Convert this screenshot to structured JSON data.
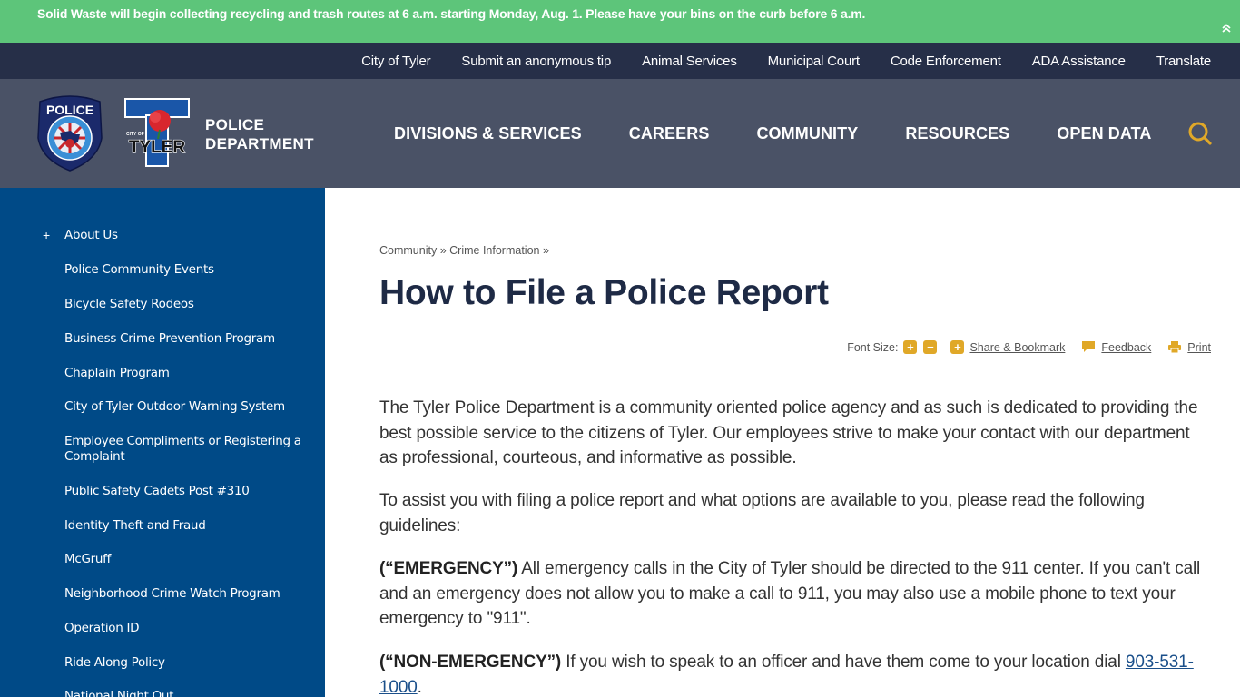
{
  "alert": {
    "message": "Solid Waste will begin collecting recycling and trash routes at 6 a.m. starting Monday, Aug. 1. Please have your bins on the curb before 6 a.m.",
    "collapse_icon": "double-chevron-up-icon"
  },
  "utility_nav": {
    "links": [
      "City of Tyler",
      "Submit an anonymous tip",
      "Animal Services",
      "Municipal Court",
      "Code Enforcement",
      "ADA Assistance",
      "Translate"
    ]
  },
  "header": {
    "police_badge_text": "POLICE",
    "tyler_logo_small": "CITY OF",
    "tyler_logo_text": "TYLER",
    "dept_line1": "POLICE",
    "dept_line2": "DEPARTMENT",
    "nav": [
      "DIVISIONS & SERVICES",
      "CAREERS",
      "COMMUNITY",
      "RESOURCES",
      "OPEN DATA"
    ],
    "search_icon": "search-icon"
  },
  "sidebar": {
    "expand_symbol": "+",
    "items": [
      "About Us",
      "Police Community Events",
      "Bicycle Safety Rodeos",
      "Business Crime Prevention Program",
      "Chaplain Program",
      "City of Tyler Outdoor Warning System",
      "Employee Compliments or Registering a Complaint",
      "Public Safety Cadets Post #310",
      "Identity Theft and Fraud",
      "McGruff",
      "Neighborhood Crime Watch Program",
      "Operation ID",
      "Ride Along Policy",
      "National Night Out"
    ]
  },
  "content": {
    "breadcrumb": [
      "Community",
      "Crime Information"
    ],
    "breadcrumb_sep": "»",
    "title": "How to File a Police Report",
    "tools": {
      "font_size_label": "Font Size:",
      "increase": "+",
      "decrease": "−",
      "share_label": "Share & Bookmark",
      "feedback_label": "Feedback",
      "print_label": "Print"
    },
    "paragraphs": {
      "p1": "The Tyler Police Department is a community oriented police agency and as such is dedicated to providing the best possible service to the citizens of Tyler. Our employees strive to make your contact with our department as professional, courteous, and informative as possible.",
      "p2": "To assist you with filing a police report and what options are available to you, please read the following guidelines:",
      "p3_bold": "(“EMERGENCY”)",
      "p3_text": " All emergency calls in the City of Tyler should be directed to the 911 center. If you can't call and an emergency does not allow you to make a call to 911, you may also use a mobile phone to text your emergency to \"911\".",
      "p4_bold": "(“NON-EMERGENCY”)",
      "p4_text": " If you wish to speak to an officer and have them come to your location dial ",
      "p4_phone": "903-531-1000",
      "p4_end": "."
    }
  },
  "colors": {
    "alert_bg": "#5dc57a",
    "utility_bg": "#262f48",
    "header_bg": "#4a5266",
    "sidebar_bg": "#004a87",
    "accent": "#e0a828",
    "title": "#1e2a45",
    "link": "#1a4f8a"
  }
}
